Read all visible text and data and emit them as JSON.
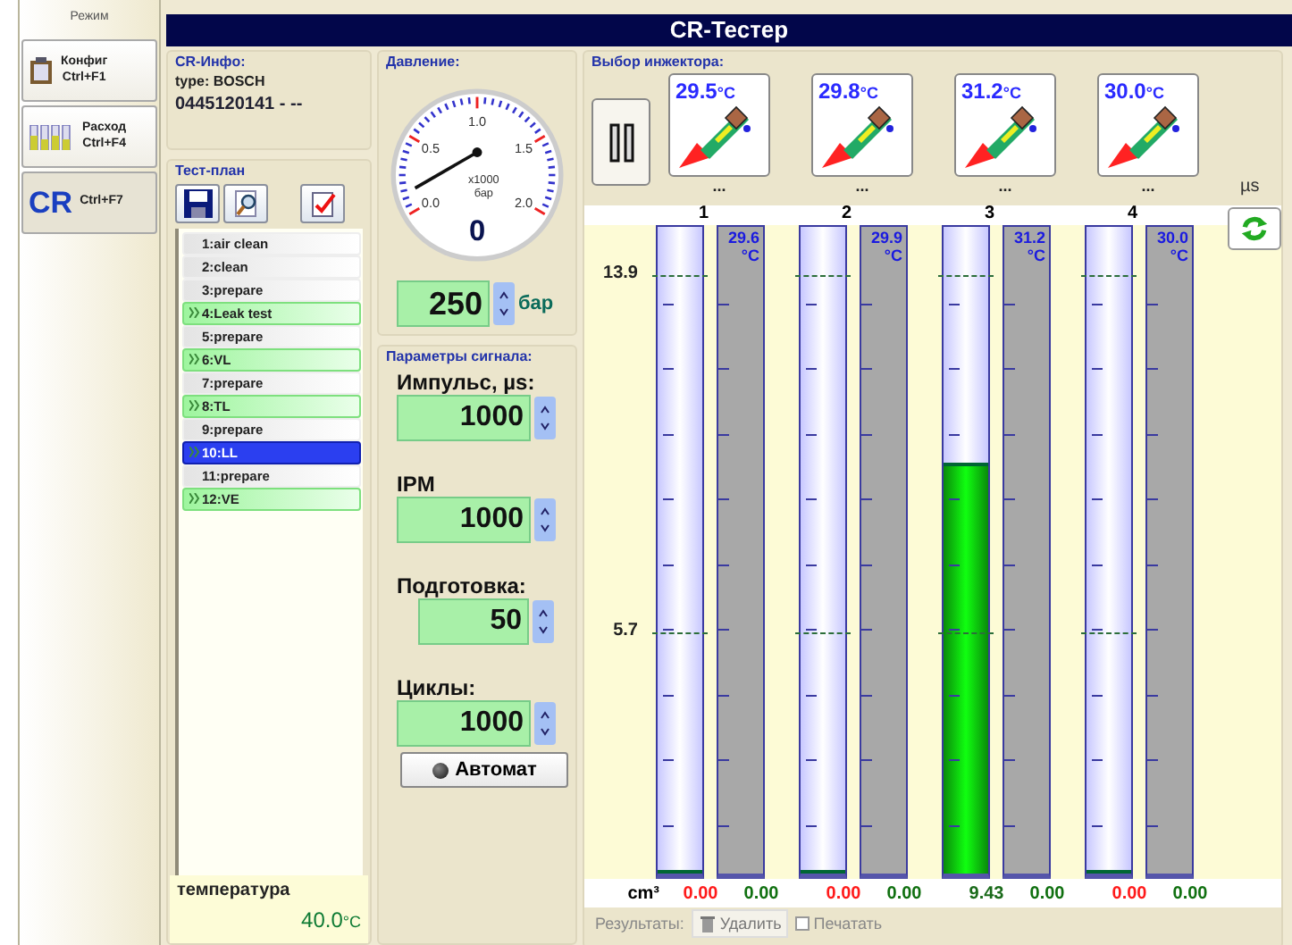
{
  "sidebar": {
    "title": "Режим",
    "items": [
      {
        "label": "Конфиг",
        "shortcut": "Ctrl+F1",
        "kind": "config",
        "selected": false
      },
      {
        "label": "Расход",
        "shortcut": "Ctrl+F4",
        "kind": "flow",
        "selected": false
      },
      {
        "label": "CR",
        "shortcut": "Ctrl+F7",
        "kind": "cr",
        "selected": true
      }
    ]
  },
  "window": {
    "title": "CR-Тестер"
  },
  "cr_info": {
    "title": "CR-Инфо:",
    "type": "type: BOSCH",
    "part_number": "0445120141 - --"
  },
  "test_plan": {
    "title": "Тест-план",
    "items": [
      {
        "label": "1:air clean",
        "kind": "step",
        "selected": false
      },
      {
        "label": "2:clean",
        "kind": "step",
        "selected": false
      },
      {
        "label": "3:prepare",
        "kind": "step",
        "selected": false
      },
      {
        "label": "4:Leak test",
        "kind": "test",
        "selected": false
      },
      {
        "label": "5:prepare",
        "kind": "step",
        "selected": false
      },
      {
        "label": "6:VL",
        "kind": "test",
        "selected": false
      },
      {
        "label": "7:prepare",
        "kind": "step",
        "selected": false
      },
      {
        "label": "8:TL",
        "kind": "test",
        "selected": false
      },
      {
        "label": "9:prepare",
        "kind": "step",
        "selected": false
      },
      {
        "label": "10:LL",
        "kind": "test",
        "selected": true
      },
      {
        "label": "11:prepare",
        "kind": "step",
        "selected": false
      },
      {
        "label": "12:VE",
        "kind": "test",
        "selected": false
      }
    ]
  },
  "temperature": {
    "label": "температура",
    "value": "40.0",
    "unit": "°C"
  },
  "pressure": {
    "title": "Давление:",
    "gauge": {
      "labels": [
        "0.0",
        "0.5",
        "1.0",
        "1.5",
        "2.0"
      ],
      "multiplier": "x1000",
      "unit": "бар",
      "reading": "0"
    },
    "setpoint": "250",
    "unit": "бар"
  },
  "signal": {
    "title": "Параметры сигнала:",
    "fields": [
      {
        "label": "Импульс, µs:",
        "value": "1000",
        "kind": "wide"
      },
      {
        "label": "IPM",
        "value": "1000",
        "kind": "wide"
      },
      {
        "label": "Подготовка:",
        "value": "50",
        "kind": "narrow"
      },
      {
        "label": "Циклы:",
        "value": "1000",
        "kind": "wide"
      }
    ],
    "auto_button": "Автомат"
  },
  "injectors": {
    "title": "Выбор инжектора:",
    "unit": "µs",
    "items": [
      {
        "temp": "29.5",
        "unit": "°C",
        "pulse": "..."
      },
      {
        "temp": "29.8",
        "unit": "°C",
        "pulse": "..."
      },
      {
        "temp": "31.2",
        "unit": "°C",
        "pulse": "..."
      },
      {
        "temp": "30.0",
        "unit": "°C",
        "pulse": "..."
      }
    ]
  },
  "measurement": {
    "unit": "cm³",
    "marks": [
      {
        "label": "13.9",
        "level": 0.927
      },
      {
        "label": "5.7",
        "level": 0.38
      }
    ],
    "columns": [
      {
        "number": "1",
        "level": 0,
        "temp": "29.6",
        "temp_unit": "°C",
        "reading": "0.00",
        "return_reading": "0.00"
      },
      {
        "number": "2",
        "level": 0,
        "temp": "29.9",
        "temp_unit": "°C",
        "reading": "0.00",
        "return_reading": "0.00"
      },
      {
        "number": "3",
        "level": 0.63,
        "temp": "31.2",
        "temp_unit": "°C",
        "reading": "9.43",
        "return_reading": "0.00"
      },
      {
        "number": "4",
        "level": 0,
        "temp": "30.0",
        "temp_unit": "°C",
        "reading": "0.00",
        "return_reading": "0.00"
      }
    ]
  },
  "results": {
    "label": "Результаты:",
    "delete_button": "Удалить",
    "print": {
      "label": "Печатать",
      "checked": false
    }
  }
}
